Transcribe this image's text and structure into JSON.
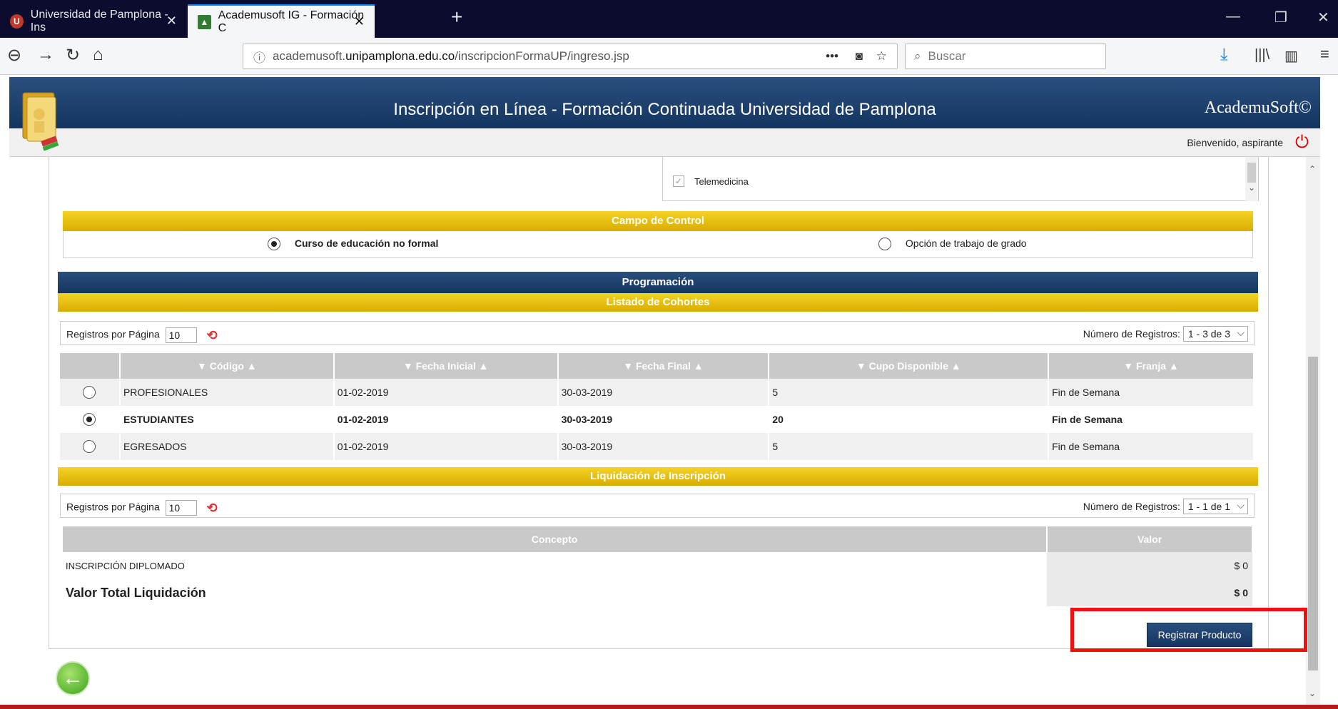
{
  "browser": {
    "tabs": [
      {
        "label": "Universidad de Pamplona - Ins",
        "active": false
      },
      {
        "label": "Academusoft IG - Formación C",
        "active": true
      }
    ],
    "url_prefix": "academusoft.",
    "url_domain": "unipamplona.edu.co",
    "url_path": "/inscripcionFormaUP/ingreso.jsp",
    "search_placeholder": "Buscar"
  },
  "header": {
    "title": "Inscripción en Línea - Formación Continuada Universidad de Pamplona",
    "brand": "AcademuSoft©",
    "welcome": "Bienvenido, aspirante"
  },
  "listbox": {
    "item": "Telemedicina"
  },
  "control": {
    "title": "Campo de Control",
    "option1": "Curso de educación no formal",
    "option2": "Opción de trabajo de grado",
    "selected": 1
  },
  "programacion": {
    "title": "Programación",
    "list_title": "Listado de Cohortes",
    "per_page_label": "Registros por Página",
    "per_page_value": "10",
    "count_label": "Número de Registros:",
    "count_value": "1 - 3 de 3",
    "columns": [
      "▼ Código ▲",
      "▼ Fecha Inicial ▲",
      "▼ Fecha Final ▲",
      "▼ Cupo Disponible ▲",
      "▼ Franja ▲"
    ],
    "rows": [
      {
        "codigo": "PROFESIONALES",
        "inicio": "01-02-2019",
        "fin": "30-03-2019",
        "cupo": "5",
        "franja": "Fin de Semana",
        "selected": false
      },
      {
        "codigo": "ESTUDIANTES",
        "inicio": "01-02-2019",
        "fin": "30-03-2019",
        "cupo": "20",
        "franja": "Fin de Semana",
        "selected": true
      },
      {
        "codigo": "EGRESADOS",
        "inicio": "01-02-2019",
        "fin": "30-03-2019",
        "cupo": "5",
        "franja": "Fin de Semana",
        "selected": false
      }
    ]
  },
  "liquidacion": {
    "title": "Liquidación de Inscripción",
    "per_page_label": "Registros por Página",
    "per_page_value": "10",
    "count_label": "Número de Registros:",
    "count_value": "1 - 1 de 1",
    "col_concepto": "Concepto",
    "col_valor": "Valor",
    "item_concepto": "INSCRIPCIÓN DIPLOMADO",
    "item_valor": "$ 0",
    "total_label": "Valor Total Liquidación",
    "total_valor": "$ 0"
  },
  "actions": {
    "register": "Registrar Producto"
  },
  "colors": {
    "header_blue": "#14355f",
    "band_gold": "#e0b800",
    "highlight_red": "#ee1111"
  }
}
